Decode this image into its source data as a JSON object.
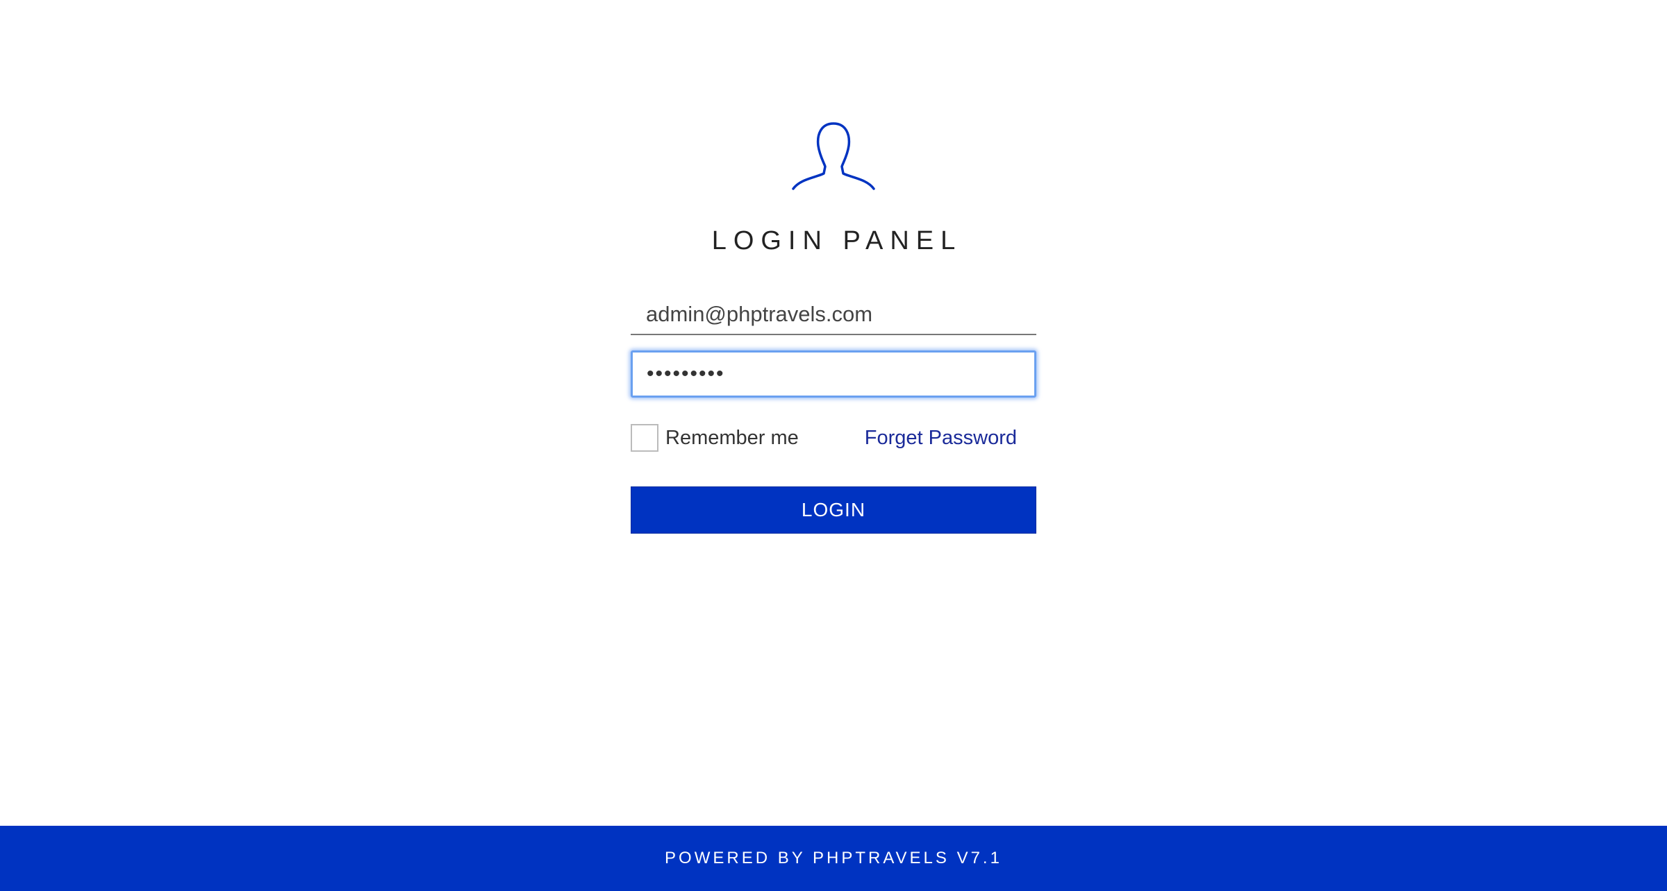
{
  "login_panel": {
    "title": "LOGIN PANEL",
    "avatar_icon": "user-silhouette-icon",
    "email_value": "admin@phptravels.com",
    "password_value": "•••••••••",
    "remember_label": "Remember me",
    "forget_password_label": "Forget Password",
    "login_button_label": "LOGIN"
  },
  "footer": {
    "text": "POWERED BY PHPTRAVELS V7.1"
  },
  "colors": {
    "brand_blue": "#0033c1",
    "link_blue": "#1a2a99",
    "focus_ring": "#6aa0f0"
  }
}
